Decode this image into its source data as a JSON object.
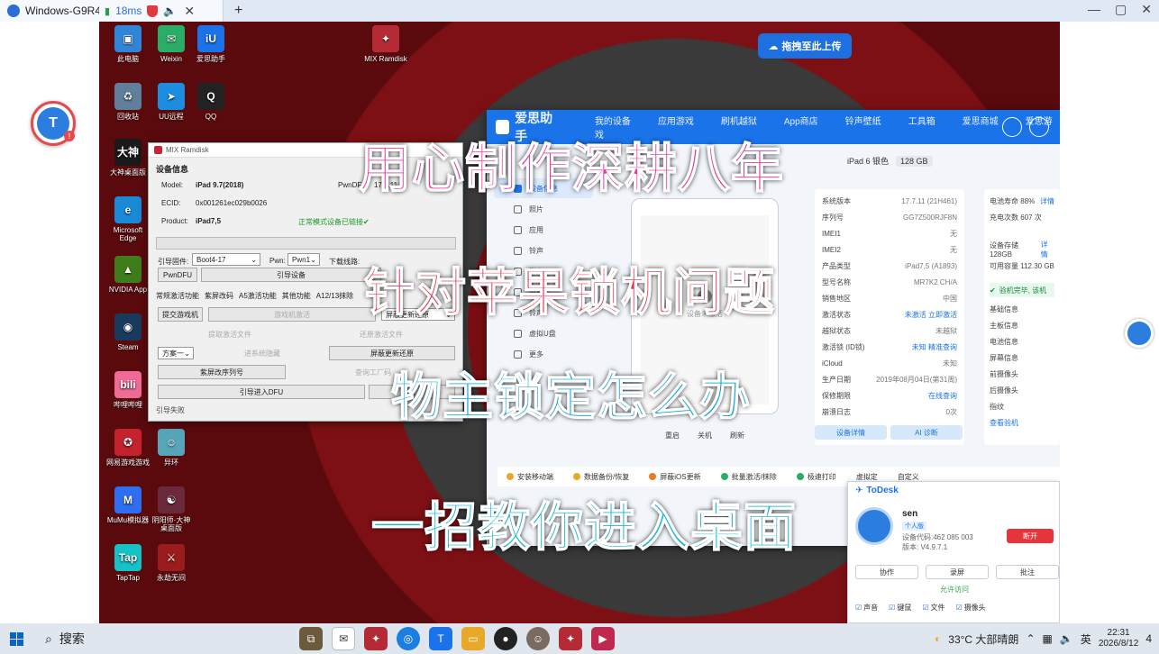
{
  "remote_window": {
    "tab_title": "Windows-G9R4...",
    "latency": "18ms",
    "new_tab": "+",
    "controls": [
      "—",
      "▢",
      "✕"
    ]
  },
  "desktop_icons": [
    {
      "label": "此电脑",
      "color": "#2f86d6",
      "glyph": "▣"
    },
    {
      "label": "Weixin",
      "color": "#2aae67",
      "glyph": "✉"
    },
    {
      "label": "爱思助手",
      "color": "#1a73e8",
      "glyph": "iU"
    },
    {
      "label": "MIX Ramdisk",
      "color": "#b42b35",
      "glyph": "✦"
    },
    {
      "label": "回收站",
      "color": "#5f7f9a",
      "glyph": "♻"
    },
    {
      "label": "UU远程",
      "color": "#1b8ee0",
      "glyph": "➤"
    },
    {
      "label": "QQ",
      "color": "#222",
      "glyph": "Q"
    },
    {
      "label": "大神桌面版",
      "color": "#1a1a1a",
      "glyph": "大神"
    },
    {
      "label": "Microsoft Edge",
      "color": "#1a8ad6",
      "glyph": "e"
    },
    {
      "label": "NVIDIA App",
      "color": "#3f7d1a",
      "glyph": "▲"
    },
    {
      "label": "Steam",
      "color": "#183a5c",
      "glyph": "◉"
    },
    {
      "label": "哔哩哔哩",
      "color": "#f06a98",
      "glyph": "bili"
    },
    {
      "label": "网易游戏游戏",
      "color": "#c4232e",
      "glyph": "✪"
    },
    {
      "label": "异环",
      "color": "#56a5b8",
      "glyph": "☺"
    },
    {
      "label": "MuMu模拟器",
      "color": "#2d6ff0",
      "glyph": "M"
    },
    {
      "label": "阴阳师·大神桌面版",
      "color": "#6a2a3c",
      "glyph": "☯"
    },
    {
      "label": "TapTap",
      "color": "#14c2c7",
      "glyph": "Tap"
    },
    {
      "label": "永劫无间",
      "color": "#9a1c1c",
      "glyph": "⚔"
    }
  ],
  "upload_button": "拖拽至此上传",
  "mix": {
    "title": "MIX Ramdisk",
    "section": "设备信息",
    "model_label": "Model:",
    "model_value": "iPad 9.7(2018)",
    "pwn_label": "PwnDFU",
    "pwn_value": "17.7.11",
    "ecid_label": "ECID:",
    "ecid_value": "0x001261ec029b0026",
    "product_label": "Product:",
    "product_value": "iPad7,5",
    "connected": "正常模式设备已链接✔",
    "boot_label": "引导固件:",
    "boot_value": "Boot4-17",
    "pwn_select_label": "Pwn:",
    "pwn_select_value": "Pwn1",
    "download_label": "下载线路:",
    "pwndfu_btn": "PwnDFU",
    "boot_device_btn": "引导设备",
    "tabs": [
      "常规激活功能",
      "紫屏改码",
      "A5激活功能",
      "其他功能",
      "A12/13抹除"
    ],
    "submit_btn": "提交游戏机",
    "game_btn": "游戏机激活",
    "hide_select": "屏蔽更新还原",
    "extract_btn": "提取激活文件",
    "restore_btn": "还原激活文件",
    "mode_select": "方案一",
    "hide_btn": "进系统隐藏",
    "hide_restore_btn": "屏蔽更新还原",
    "purple_btn": "紫屏改序列号",
    "factory_btn": "查询工厂码",
    "dfu_btn": "引导进入DFU",
    "dfu_btn2": "禁",
    "status": "引导失败"
  },
  "aisi": {
    "brand": "爱思助手",
    "nav": [
      "我的设备",
      "应用游戏",
      "刷机越狱",
      "App商店",
      "铃声壁纸",
      "工具箱",
      "爱思商城",
      "爱思游戏"
    ],
    "device_name": "iPad 6 银色",
    "capacity": "128 GB",
    "sidebar": [
      {
        "label": "设备信息",
        "active": true
      },
      {
        "label": "照片",
        "active": false
      },
      {
        "label": "应用",
        "active": false
      },
      {
        "label": "铃声",
        "active": false
      },
      {
        "label": "影音",
        "active": false
      },
      {
        "label": "资料",
        "active": false
      },
      {
        "label": "铃声",
        "active": false
      },
      {
        "label": "虚拟U盘",
        "active": false
      },
      {
        "label": "更多",
        "active": false
      }
    ],
    "lock_caption": "设备未激活",
    "phone_actions": [
      "重启",
      "关机",
      "刷新"
    ],
    "info_rows": [
      {
        "k": "系统版本",
        "v": "17.7.11 (21H461)"
      },
      {
        "k": "序列号",
        "v": "GG7Z500RJF8N"
      },
      {
        "k": "IMEI1",
        "v": "无"
      },
      {
        "k": "IMEI2",
        "v": "无"
      },
      {
        "k": "产品类型",
        "v": "iPad7,5 (A1893)"
      },
      {
        "k": "型号名称",
        "v": "MR7K2 CH/A"
      },
      {
        "k": "销售地区",
        "v": "中国"
      },
      {
        "k": "激活状态",
        "v": "未激活 立即激活"
      },
      {
        "k": "越狱状态",
        "v": "未越狱"
      },
      {
        "k": "激活锁 (ID锁)",
        "v": "未知 精准查询"
      },
      {
        "k": "iCloud",
        "v": "未知"
      },
      {
        "k": "生产日期",
        "v": "2019年08月04日(第31周)"
      },
      {
        "k": "保修期限",
        "v": "在线查询"
      },
      {
        "k": "崩溃日志",
        "v": "0次"
      }
    ],
    "info_buttons": [
      "设备详情",
      "AI 诊断"
    ],
    "right_rows": [
      {
        "k": "电池寿命 88%",
        "v": "详情"
      },
      {
        "k": "充电次数 607 次",
        "v": ""
      },
      {
        "k": "",
        "v": ""
      },
      {
        "k": "设备存储 128GB",
        "v": "详情"
      },
      {
        "k": "可用容量 112.30 GB",
        "v": ""
      }
    ],
    "verify": "验机完毕, 该机",
    "right_list": [
      "基础信息",
      "主板信息",
      "电池信息",
      "屏幕信息",
      "前摄像头",
      "后摄像头",
      "指纹"
    ],
    "right_btn": "查看验机",
    "tools": [
      "安装移动端",
      "数据备份/恢复",
      "屏蔽iOS更新",
      "批量激活/抹除",
      "极速打印"
    ],
    "tools_more": [
      "虚拟定",
      "自定义"
    ]
  },
  "todesk": {
    "title": "ToDesk",
    "name": "sen",
    "tag": "个人版",
    "code_label": "设备代码:462 085 003",
    "version_label": "版本: V4.9.7.1",
    "disconnect": "断开",
    "actions": [
      "协作",
      "录屏",
      "批注"
    ],
    "allow": "允许访问",
    "opts": [
      "声音",
      "键鼠",
      "文件",
      "摄像头"
    ]
  },
  "overlay": {
    "line1": "用心制作深耕八年",
    "line2": "针对苹果锁机问题",
    "line3": "物主锁定怎么办",
    "line4": "一招教你进入桌面"
  },
  "taskbar": {
    "search": "搜索",
    "weather": "33°C 大部晴朗",
    "ime": "英",
    "time": "22:31",
    "date": "2026/8/12",
    "notif": "4"
  },
  "colors": {
    "accent": "#1a73e8",
    "danger": "#e5353a"
  }
}
